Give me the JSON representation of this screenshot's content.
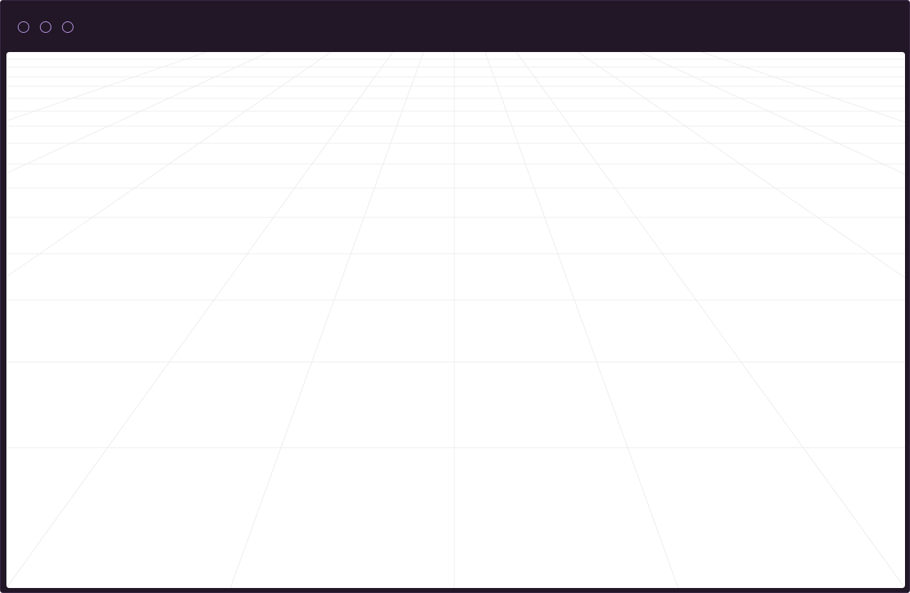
{
  "window": {
    "controls": [
      {
        "icon": "close-circle-icon"
      },
      {
        "icon": "minimize-circle-icon"
      },
      {
        "icon": "maximize-circle-icon"
      }
    ]
  },
  "colors": {
    "chrome": "#211726",
    "control_outline": "#c59cf0",
    "viewport_background": "#ffffff",
    "grid_lines": "#ececec"
  },
  "viewport": {
    "background": "perspective-grid"
  }
}
